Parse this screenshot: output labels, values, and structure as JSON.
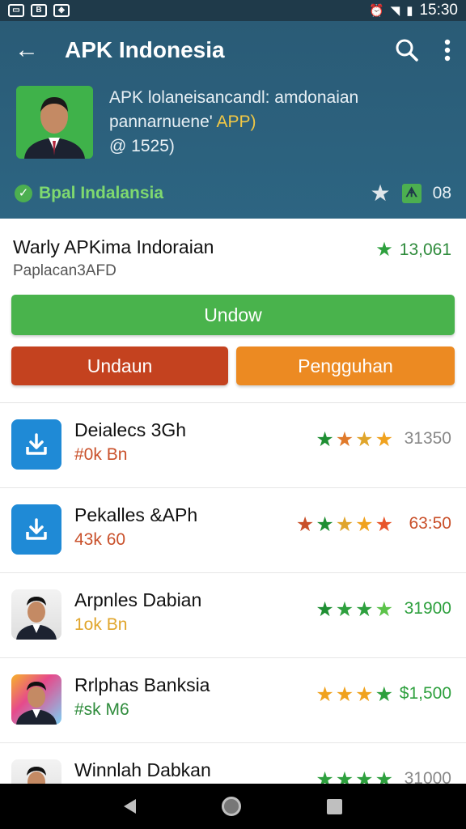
{
  "status_bar": {
    "time": "15:30",
    "icons": [
      "gallery-icon",
      "b-app-icon",
      "compass-icon"
    ]
  },
  "appbar": {
    "title": "APK Indonesia"
  },
  "hero": {
    "line1": "APK lolaneisancandl: amdonaian",
    "line2_prefix": "pannarnuene'",
    "line2_accent": "APP)",
    "line3": "@ 1525)",
    "verified_label": "Bpal Indalansia",
    "badge_count": "08"
  },
  "summary": {
    "title": "Warly APKima Indoraian",
    "subtitle": "Paplacan3AFD",
    "rating": "13,061",
    "primary_button": "Undow",
    "danger_button": "Undaun",
    "warning_button": "Pengguhan"
  },
  "apps": [
    {
      "name": "Deialecs 3Gh",
      "size": "#0k Bn",
      "size_color": "#c9502a",
      "count": "31350",
      "count_color": "#888888",
      "icon": "download-icon",
      "stars": [
        "#1f8f33",
        "#e07a2b",
        "#e0a52b",
        "#f0a21e"
      ]
    },
    {
      "name": "Pekalles &APh",
      "size": "43k 60",
      "size_color": "#c9502a",
      "count": "63:50",
      "count_color": "#c9502a",
      "icon": "download-icon",
      "stars": [
        "#c9502a",
        "#1f8f33",
        "#e0a52b",
        "#f0a21e",
        "#e8552a"
      ]
    },
    {
      "name": "Arpnles Dabian",
      "size": "1ok Bn",
      "size_color": "#e0a52b",
      "count": "31900",
      "count_color": "#2ea03e",
      "icon": "person-icon",
      "stars": [
        "#1f8f33",
        "#2ea03e",
        "#2ea03e",
        "#5cc34a"
      ]
    },
    {
      "name": "Rrlphas Banksia",
      "size": "#sk M6",
      "size_color": "#2e8b3b",
      "count": "$1,500",
      "count_color": "#2ea03e",
      "icon": "person-icon",
      "stars": [
        "#f0a21e",
        "#f0a21e",
        "#f0a21e",
        "#2ea03e"
      ]
    },
    {
      "name": "Winnlah Dabkan",
      "size": "",
      "size_color": "#888888",
      "count": "31000",
      "count_color": "#888888",
      "icon": "person-icon",
      "stars": [
        "#2ea03e",
        "#2ea03e",
        "#2ea03e",
        "#2ea03e"
      ]
    }
  ]
}
